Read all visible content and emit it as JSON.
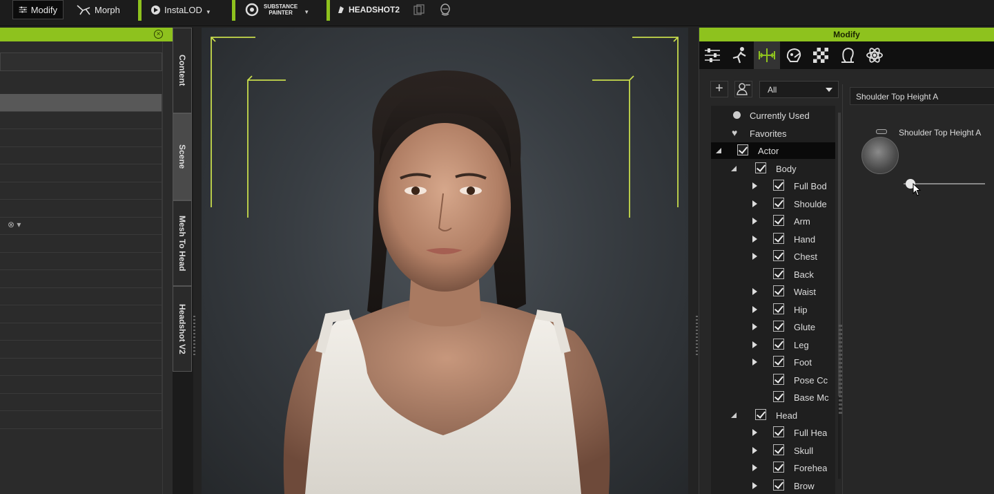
{
  "toolbar": {
    "modify_label": "Modify",
    "morph_label": "Morph",
    "instalod_label": "InstaLOD",
    "substance_line1": "SUBSTANCE",
    "substance_line2": "PAINTER",
    "headshot_label": "HEADSHOT2",
    "accent_color": "#8ec21e"
  },
  "left_panel": {
    "close_icon": "close-circle-icon",
    "row_count": 19,
    "selected_row": 0
  },
  "side_tabs": [
    "Content",
    "Scene",
    "Mesh To Head",
    "Headshot V2"
  ],
  "right_panel": {
    "title": "Modify",
    "icons": [
      "sliders-icon",
      "pose-icon",
      "morph-icon",
      "face-icon",
      "checker-icon",
      "head-icon",
      "atom-icon"
    ],
    "filter_value": "All",
    "tree": [
      {
        "label": "Currently Used",
        "kind": "dot",
        "level": 0
      },
      {
        "label": "Favorites",
        "kind": "heart",
        "level": 0
      },
      {
        "label": "Actor",
        "kind": "collapse",
        "level": 0,
        "selected": true
      },
      {
        "label": "Body",
        "kind": "collapse",
        "level": 1
      },
      {
        "label": "Full Bod",
        "kind": "expand",
        "level": 2
      },
      {
        "label": "Shoulde",
        "kind": "expand",
        "level": 2
      },
      {
        "label": "Arm",
        "kind": "expand",
        "level": 2
      },
      {
        "label": "Hand",
        "kind": "expand",
        "level": 2
      },
      {
        "label": "Chest",
        "kind": "expand",
        "level": 2
      },
      {
        "label": "Back",
        "kind": "leaf",
        "level": 2
      },
      {
        "label": "Waist",
        "kind": "expand",
        "level": 2
      },
      {
        "label": "Hip",
        "kind": "expand",
        "level": 2
      },
      {
        "label": "Glute",
        "kind": "expand",
        "level": 2
      },
      {
        "label": "Leg",
        "kind": "expand",
        "level": 2
      },
      {
        "label": "Foot",
        "kind": "expand",
        "level": 2
      },
      {
        "label": "Pose Cc",
        "kind": "leaf",
        "level": 2
      },
      {
        "label": "Base Mc",
        "kind": "leaf",
        "level": 2
      },
      {
        "label": "Head",
        "kind": "collapse",
        "level": 1
      },
      {
        "label": "Full Hea",
        "kind": "expand",
        "level": 2
      },
      {
        "label": "Skull",
        "kind": "expand",
        "level": 2
      },
      {
        "label": "Forehea",
        "kind": "expand",
        "level": 2
      },
      {
        "label": "Brow",
        "kind": "expand",
        "level": 2
      }
    ],
    "slider_header": "Shoulder Top Height A",
    "slider_title": "Shoulder Top Height A",
    "slider_value": 0.0
  }
}
